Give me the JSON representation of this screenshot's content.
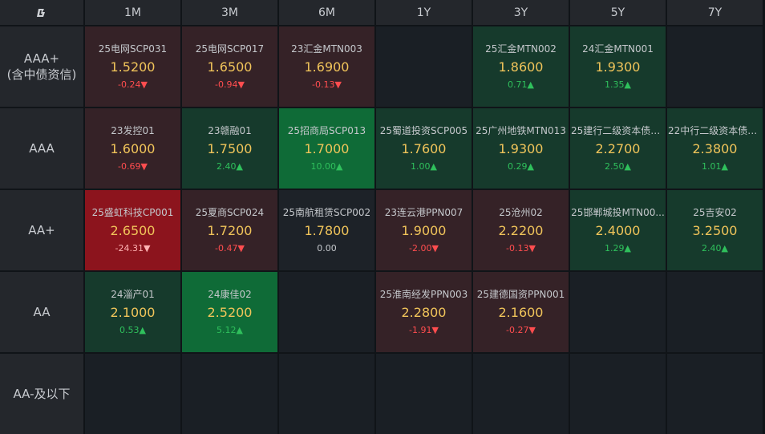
{
  "corner_icon": "app-logo-icon",
  "tenors": [
    "1M",
    "3M",
    "6M",
    "1Y",
    "3Y",
    "5Y",
    "7Y"
  ],
  "ratings": [
    {
      "line1": "AAA+",
      "line2": "(含中债资信)"
    },
    {
      "line1": "AAA",
      "line2": ""
    },
    {
      "line1": "AA+",
      "line2": ""
    },
    {
      "line1": "AA",
      "line2": ""
    },
    {
      "line1": "AA-及以下",
      "line2": ""
    }
  ],
  "arrows": {
    "up": "▲",
    "down": "▼"
  },
  "colors": {
    "yield": "#f0c45a",
    "up": "#2fc05c",
    "down": "#ff4d4f",
    "up_light_bg": "#163a2c",
    "up_strong_bg": "#0f6b37",
    "down_light_bg": "#352227",
    "down_strong_bg": "#8c141d"
  },
  "cells": [
    [
      {
        "name": "25电网SCP031",
        "yield": "1.5200",
        "change": "-0.24",
        "dir": "down",
        "tone": "dn1"
      },
      {
        "name": "25电网SCP017",
        "yield": "1.6500",
        "change": "-0.94",
        "dir": "down",
        "tone": "dn1"
      },
      {
        "name": "23汇金MTN003",
        "yield": "1.6900",
        "change": "-0.13",
        "dir": "down",
        "tone": "dn1"
      },
      null,
      {
        "name": "25汇金MTN002",
        "yield": "1.8600",
        "change": "0.71",
        "dir": "up",
        "tone": "up1"
      },
      {
        "name": "24汇金MTN001",
        "yield": "1.9300",
        "change": "1.35",
        "dir": "up",
        "tone": "up1"
      },
      null
    ],
    [
      {
        "name": "23发控01",
        "yield": "1.6000",
        "change": "-0.69",
        "dir": "down",
        "tone": "dn1"
      },
      {
        "name": "23赣融01",
        "yield": "1.7500",
        "change": "2.40",
        "dir": "up",
        "tone": "up1"
      },
      {
        "name": "25招商局SCP013",
        "yield": "1.7000",
        "change": "10.00",
        "dir": "up",
        "tone": "up2"
      },
      {
        "name": "25蜀道投资SCP005",
        "yield": "1.7600",
        "change": "1.00",
        "dir": "up",
        "tone": "up1"
      },
      {
        "name": "25广州地铁MTN013",
        "yield": "1.9300",
        "change": "0.29",
        "dir": "up",
        "tone": "up1"
      },
      {
        "name": "25建行二级资本债0...",
        "yield": "2.2700",
        "change": "2.50",
        "dir": "up",
        "tone": "up1"
      },
      {
        "name": "22中行二级资本债0...",
        "yield": "2.3800",
        "change": "1.01",
        "dir": "up",
        "tone": "up1"
      }
    ],
    [
      {
        "name": "25盛虹科技CP001",
        "yield": "2.6500",
        "change": "-24.31",
        "dir": "down",
        "tone": "dn2"
      },
      {
        "name": "25夏商SCP024",
        "yield": "1.7200",
        "change": "-0.47",
        "dir": "down",
        "tone": "dn1"
      },
      {
        "name": "25南航租赁SCP002",
        "yield": "1.7800",
        "change": "0.00",
        "dir": "flat",
        "tone": "flat"
      },
      {
        "name": "23连云港PPN007",
        "yield": "1.9000",
        "change": "-2.00",
        "dir": "down",
        "tone": "dn1"
      },
      {
        "name": "25沧州02",
        "yield": "2.2200",
        "change": "-0.13",
        "dir": "down",
        "tone": "dn1"
      },
      {
        "name": "25邯郸城投MTN00...",
        "yield": "2.4000",
        "change": "1.29",
        "dir": "up",
        "tone": "up1"
      },
      {
        "name": "25吉安02",
        "yield": "3.2500",
        "change": "2.40",
        "dir": "up",
        "tone": "up1"
      }
    ],
    [
      {
        "name": "24淄产01",
        "yield": "2.1000",
        "change": "0.53",
        "dir": "up",
        "tone": "up1"
      },
      {
        "name": "24康佳02",
        "yield": "2.5200",
        "change": "5.12",
        "dir": "up",
        "tone": "up2"
      },
      null,
      {
        "name": "25淮南经发PPN003",
        "yield": "2.2800",
        "change": "-1.91",
        "dir": "down",
        "tone": "dn1"
      },
      {
        "name": "25建德国资PPN001",
        "yield": "2.1600",
        "change": "-0.27",
        "dir": "down",
        "tone": "dn1"
      },
      null,
      null
    ],
    [
      null,
      null,
      null,
      null,
      null,
      null,
      null
    ]
  ]
}
